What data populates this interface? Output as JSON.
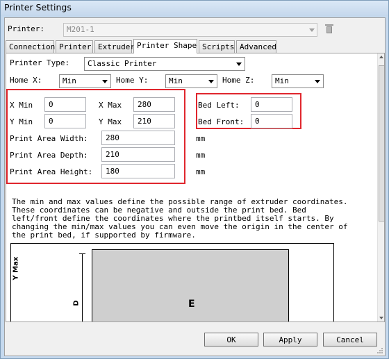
{
  "window": {
    "title": "Printer Settings"
  },
  "printer": {
    "label": "Printer:",
    "value": "M201-1",
    "delete_icon": "trash-icon"
  },
  "tabs": [
    {
      "label": "Connection"
    },
    {
      "label": "Printer"
    },
    {
      "label": "Extruder"
    },
    {
      "label": "Printer Shape"
    },
    {
      "label": "Scripts"
    },
    {
      "label": "Advanced"
    }
  ],
  "active_tab": "Printer Shape",
  "shape": {
    "printer_type_label": "Printer Type:",
    "printer_type_value": "Classic Printer",
    "home_x_label": "Home X:",
    "home_x_value": "Min",
    "home_y_label": "Home Y:",
    "home_y_value": "Min",
    "home_z_label": "Home Z:",
    "home_z_value": "Min",
    "x_min_label": "X Min",
    "x_min_value": "0",
    "x_max_label": "X Max",
    "x_max_value": "280",
    "y_min_label": "Y Min",
    "y_min_value": "0",
    "y_max_label": "Y Max",
    "y_max_value": "210",
    "bed_left_label": "Bed Left:",
    "bed_left_value": "0",
    "bed_front_label": "Bed Front:",
    "bed_front_value": "0",
    "width_label": "Print Area Width:",
    "width_value": "280",
    "width_unit": "mm",
    "depth_label": "Print Area Depth:",
    "depth_value": "210",
    "depth_unit": "mm",
    "height_label": "Print Area Height:",
    "height_value": "180",
    "height_unit": "mm",
    "help_text": "The min and max values define the possible range of extruder coordinates.\nThese coordinates can be negative and outside the print bed. Bed\nleft/front define the coordinates where the printbed itself starts. By\nchanging the min/max values you can even move the origin in the center of\nthe print bed, if supported by firmware."
  },
  "diagram": {
    "y_max_label": "Y Max",
    "d_label": "D",
    "e_label": "E",
    "bed_color": "#cfcfcf"
  },
  "buttons": {
    "ok": "OK",
    "apply": "Apply",
    "cancel": "Cancel"
  },
  "highlight_color": "#e0262d"
}
